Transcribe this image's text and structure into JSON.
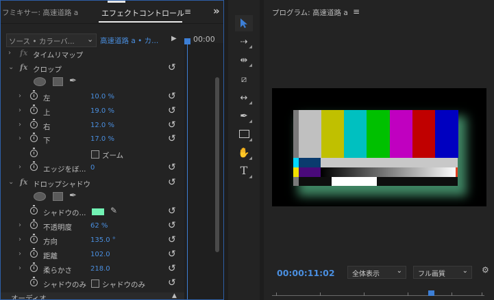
{
  "effect_controls": {
    "tab_source": "フミキサー: 高速道路 a",
    "tab_active": "エフェクトコントロール",
    "menu_icon": "≡",
    "more_icon": "»",
    "source_label": "ソース • カラーバ...",
    "clip_label": "高速道路 a • カ...",
    "timecode": "00:00",
    "rows": {
      "time_remap": "タイムリマップ",
      "crop": "クロップ",
      "left": {
        "label": "左",
        "value": "10.0 %"
      },
      "top": {
        "label": "上",
        "value": "19.0 %"
      },
      "right": {
        "label": "右",
        "value": "12.0 %"
      },
      "bottom": {
        "label": "下",
        "value": "17.0 %"
      },
      "zoom": "ズーム",
      "edge_feather": {
        "label": "エッジをぼ...",
        "value": "0"
      },
      "drop_shadow": "ドロップシャドウ",
      "shadow_color": {
        "label": "シャドウの...",
        "color": "#72f2b4"
      },
      "opacity": {
        "label": "不透明度",
        "value": "62 %"
      },
      "direction": {
        "label": "方向",
        "value": "135.0 °"
      },
      "distance": {
        "label": "距離",
        "value": "102.0"
      },
      "softness": {
        "label": "柔らかさ",
        "value": "218.0"
      },
      "shadow_only": {
        "label": "シャドウのみ",
        "checkbox_label": "シャドウのみ"
      }
    },
    "audio_label": "オーディオ"
  },
  "program_monitor": {
    "title": "プログラム: 高速道路 a",
    "menu_icon": "≡",
    "timecode": "00:00:11:02",
    "zoom_select": "全体表示",
    "quality_select": "フル画質",
    "color_bars": [
      "#c0c0c0",
      "#c0c000",
      "#00c0c0",
      "#00c000",
      "#c000c0",
      "#c00000",
      "#0000c0"
    ],
    "shadow_color": "#72f2b4"
  },
  "toolbar": {
    "tools": [
      "selection-tool",
      "track-select-tool",
      "ripple-edit-tool",
      "razor-tool",
      "slip-tool",
      "pen-tool",
      "rectangle-tool",
      "hand-tool",
      "type-tool"
    ]
  }
}
